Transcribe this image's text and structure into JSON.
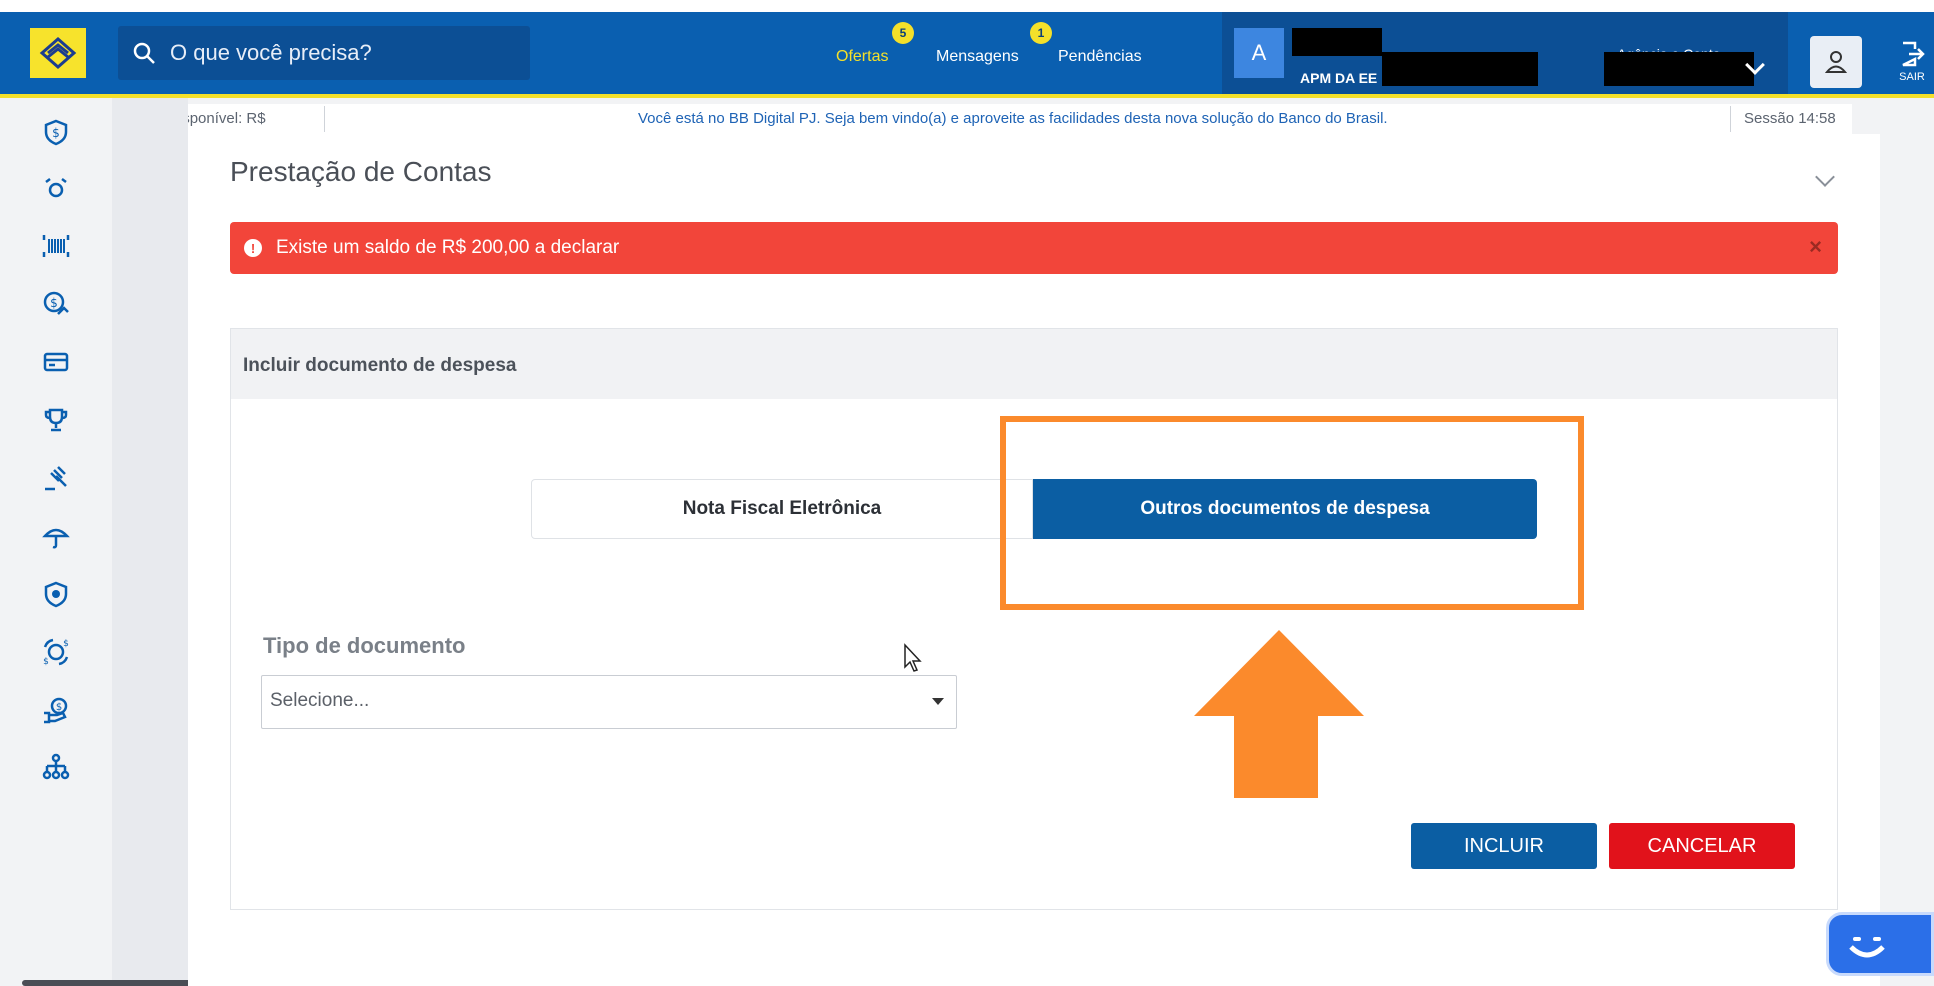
{
  "header": {
    "search_placeholder": "O que você precisa?",
    "nav": [
      {
        "label": "Ofertas",
        "badge": "5"
      },
      {
        "label": "Mensagens",
        "badge": "1"
      },
      {
        "label": "Pendências"
      }
    ],
    "account": {
      "avatar_letter": "A",
      "name_partial": "APM DA EE",
      "agencia_label": "Agência e Conta"
    },
    "logout_label": "SAIR"
  },
  "info_strip": {
    "saldo": "Saldo disponível: R$",
    "welcome": "Você está no BB Digital PJ. Seja bem vindo(a) e aproveite as facilidades desta nova solução do Banco do Brasil.",
    "session": "Sessão 14:58"
  },
  "page": {
    "title": "Prestação de Contas",
    "alert": "Existe um saldo de R$ 200,00 a declarar",
    "alert_icon": "!",
    "alert_close": "×"
  },
  "panel": {
    "title": "Incluir documento de despesa",
    "tabs": [
      {
        "label": "Nota Fiscal Eletrônica",
        "selected": false
      },
      {
        "label": "Outros documentos de despesa",
        "selected": true
      }
    ],
    "field_label": "Tipo de documento",
    "select_value": "Selecione...",
    "buttons": {
      "incluir": "INCLUIR",
      "cancelar": "CANCELAR"
    }
  },
  "sidebar_icons": [
    "shield-dollar-icon",
    "transfer-icon",
    "barcode-icon",
    "dollar-growth-icon",
    "card-icon",
    "trophy-icon",
    "auction-icon",
    "umbrella-icon",
    "shield-icon",
    "exchange-icon",
    "hand-money-icon",
    "org-chart-icon"
  ],
  "colors": {
    "brand_blue": "#0a5fb0",
    "brand_yellow": "#f4e02a",
    "alert_red": "#f2453a",
    "highlight_orange": "#fb8a2c",
    "cancel_red": "#e1121b"
  }
}
